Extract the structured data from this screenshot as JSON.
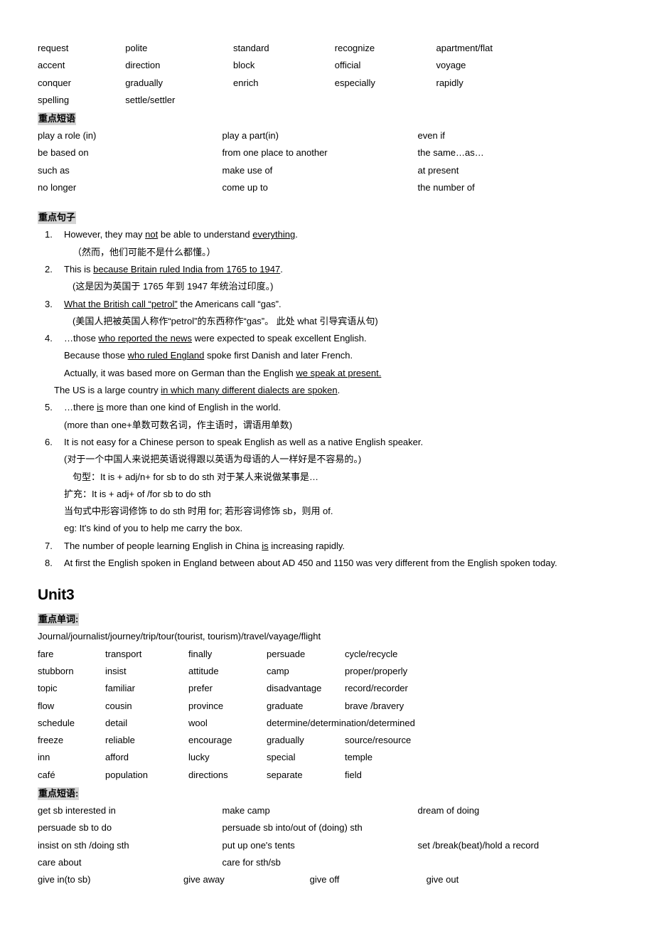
{
  "unit2": {
    "words_grid": [
      [
        "request",
        "polite",
        "standard",
        "recognize",
        "apartment/flat"
      ],
      [
        "accent",
        "direction",
        "block",
        "official",
        "voyage"
      ],
      [
        "conquer",
        " gradually",
        "enrich",
        "especially",
        " rapidly"
      ],
      [
        "spelling",
        "settle/settler",
        "",
        "",
        ""
      ]
    ],
    "phrases_heading": "重点短语",
    "phrases_grid": [
      [
        "play a role (in)",
        "play a part(in)",
        "even if"
      ],
      [
        "be based on",
        " from one place to another",
        "the same…as…"
      ],
      [
        "such as",
        " make use of",
        "at present"
      ],
      [
        "no longer",
        "  come up to",
        " the number of"
      ]
    ],
    "sentences_heading": "重点句子",
    "sentences": [
      {
        "num": "1.",
        "lines": [
          {
            "kind": "en",
            "parts": [
              {
                "t": "However, they may ",
                "u": false
              },
              {
                "t": "not",
                "u": true
              },
              {
                "t": " be able to understand ",
                "u": false
              },
              {
                "t": "everything",
                "u": true
              },
              {
                "t": ".",
                "u": false
              }
            ]
          },
          {
            "kind": "cn",
            "parts": [
              {
                "t": "（然而，他们可能不是什么都懂。）",
                "u": false
              }
            ]
          }
        ]
      },
      {
        "num": "2.",
        "lines": [
          {
            "kind": "en",
            "parts": [
              {
                "t": "This is ",
                "u": false
              },
              {
                "t": "because Britain ruled India from 1765 to 1947",
                "u": true
              },
              {
                "t": ".",
                "u": false
              }
            ]
          },
          {
            "kind": "cn",
            "parts": [
              {
                "t": "(这是因为英国于 1765 年到 1947 年统治过印度。)",
                "u": false
              }
            ]
          }
        ]
      },
      {
        "num": "3.",
        "lines": [
          {
            "kind": "en",
            "parts": [
              {
                "t": "What the British call “petrol”",
                "u": true
              },
              {
                "t": " the Americans call “gas”.",
                "u": false
              }
            ]
          },
          {
            "kind": "cn",
            "parts": [
              {
                "t": "(美国人把被英国人称作“petrol”的东西称作“gas”。  此处 what 引导宾语从句)",
                "u": false
              }
            ]
          }
        ]
      },
      {
        "num": "4.",
        "lines": [
          {
            "kind": "en",
            "parts": [
              {
                "t": "…those ",
                "u": false
              },
              {
                "t": "who reported the news",
                "u": true
              },
              {
                "t": " were expected to speak excellent English.",
                "u": false
              }
            ]
          },
          {
            "kind": "en",
            "parts": [
              {
                "t": "Because those ",
                "u": false
              },
              {
                "t": "who ruled England",
                "u": true
              },
              {
                "t": " spoke first Danish and later French.",
                "u": false
              }
            ]
          },
          {
            "kind": "en",
            "parts": [
              {
                "t": "Actually, it was based more on German than the English ",
                "u": false
              },
              {
                "t": "we speak at present.",
                "u": true
              }
            ]
          },
          {
            "kind": "outdent",
            "parts": [
              {
                "t": "The US is a large country ",
                "u": false
              },
              {
                "t": "in which many different dialects are spoken",
                "u": true
              },
              {
                "t": ".",
                "u": false
              }
            ]
          }
        ]
      },
      {
        "num": "5.",
        "lines": [
          {
            "kind": "en",
            "parts": [
              {
                "t": "…there ",
                "u": false
              },
              {
                "t": "is",
                "u": true
              },
              {
                "t": " more than one kind of English in the world.",
                "u": false
              }
            ]
          },
          {
            "kind": "cn0",
            "parts": [
              {
                "t": "(more than one+单数可数名词，作主语时，谓语用单数)",
                "u": false
              }
            ]
          }
        ]
      },
      {
        "num": "6.",
        "lines": [
          {
            "kind": "en",
            "parts": [
              {
                "t": "  It is not easy for a Chinese person to speak English as well as a native English speaker.",
                "u": false
              }
            ]
          },
          {
            "kind": "cn0",
            "parts": [
              {
                "t": "(对于一个中国人来说把英语说得跟以英语为母语的人一样好是不容易的。)",
                "u": false
              }
            ]
          },
          {
            "kind": "cn",
            "parts": [
              {
                "t": "句型：It is + adj/n+ for sb to do sth  对于某人来说做某事是…",
                "u": false
              }
            ]
          },
          {
            "kind": "cn0",
            "parts": [
              {
                "t": "扩充：It is + adj+ of /for sb to do sth",
                "u": false
              }
            ]
          },
          {
            "kind": "cn0",
            "parts": [
              {
                "t": "当句式中形容词修饰 to do sth  时用 for;  若形容词修饰 sb，则用 of.",
                "u": false
              }
            ]
          },
          {
            "kind": "cn0",
            "parts": [
              {
                "t": "eg: It's kind of you to help me carry the box.",
                "u": false
              }
            ]
          }
        ]
      },
      {
        "num": "7.",
        "lines": [
          {
            "kind": "en",
            "parts": [
              {
                "t": "The number of people learning English in China ",
                "u": false
              },
              {
                "t": "is",
                "u": true
              },
              {
                "t": " increasing rapidly.",
                "u": false
              }
            ]
          }
        ]
      },
      {
        "num": "8.",
        "lines": [
          {
            "kind": "en",
            "parts": [
              {
                "t": "At first the English spoken in England between about AD 450 and 1150 was very different from the English spoken today.",
                "u": false
              }
            ]
          }
        ]
      }
    ]
  },
  "unit3": {
    "title": "Unit3",
    "words_heading": "重点单词:",
    "words_intro": "Journal/journalist/journey/trip/tour(tourist, tourism)/travel/vayage/flight",
    "words_grid": [
      [
        "fare",
        "transport",
        "finally",
        "persuade",
        "cycle/recycle"
      ],
      [
        "stubborn",
        "insist",
        "attitude",
        "camp",
        "proper/properly"
      ],
      [
        "topic",
        "familiar",
        "prefer",
        "disadvantage",
        "record/recorder"
      ],
      [
        "flow",
        " cousin",
        " province",
        "graduate",
        "brave /bravery"
      ],
      [
        "schedule",
        "detail",
        "wool",
        "determine/determination/determined",
        ""
      ],
      [
        "freeze",
        "reliable",
        "encourage",
        " gradually",
        "source/resource"
      ],
      [
        "inn",
        "afford",
        "lucky",
        " special",
        " temple"
      ],
      [
        "café",
        "population",
        "directions",
        " separate",
        "  field"
      ]
    ],
    "phrases_heading": "重点短语:",
    "phrases_grid": [
      [
        "get sb interested in",
        " make camp",
        " dream of doing"
      ],
      [
        "persuade sb to do",
        "  persuade sb into/out of (doing) sth",
        ""
      ],
      [
        "insist on sth /doing sth",
        "  put up one's tents",
        " set /break(beat)/hold a record"
      ],
      [
        "care about",
        " care for sth/sb",
        ""
      ]
    ],
    "last_row": [
      "give in(to sb)",
      "give away",
      "give off",
      "give out"
    ]
  }
}
